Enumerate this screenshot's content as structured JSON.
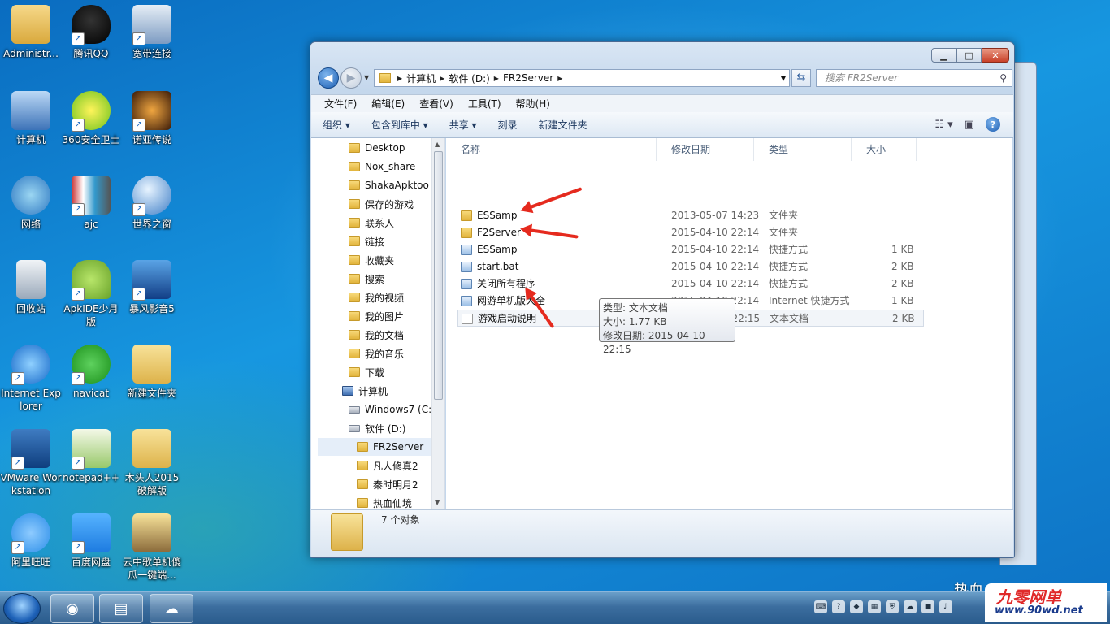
{
  "desktop": {
    "icons": [
      {
        "label": "Administr..."
      },
      {
        "label": "腾讯QQ"
      },
      {
        "label": "宽带连接"
      },
      {
        "label": "计算机"
      },
      {
        "label": "360安全卫士"
      },
      {
        "label": "诺亚传说"
      },
      {
        "label": "网络"
      },
      {
        "label": "ajc"
      },
      {
        "label": "世界之窗"
      },
      {
        "label": "回收站"
      },
      {
        "label": "ApkIDE少月版"
      },
      {
        "label": "暴风影音5"
      },
      {
        "label": "Internet Explorer"
      },
      {
        "label": "navicat"
      },
      {
        "label": "新建文件夹"
      },
      {
        "label": "VMware Workstation"
      },
      {
        "label": "notepad++"
      },
      {
        "label": "木头人2015破解版"
      },
      {
        "label": "阿里旺旺"
      },
      {
        "label": "百度网盘"
      },
      {
        "label": "云中歌单机傻瓜一键端..."
      }
    ]
  },
  "explorer": {
    "address": {
      "crumbs": [
        "计算机",
        "软件 (D:)",
        "FR2Server"
      ]
    },
    "search_placeholder": "搜索 FR2Server",
    "menu": [
      "文件(F)",
      "编辑(E)",
      "查看(V)",
      "工具(T)",
      "帮助(H)"
    ],
    "commands": [
      "组织 ▾",
      "包含到库中 ▾",
      "共享 ▾",
      "刻录",
      "新建文件夹"
    ],
    "nav_items": [
      {
        "label": "Desktop"
      },
      {
        "label": "Nox_share"
      },
      {
        "label": "ShakaApktoo"
      },
      {
        "label": "保存的游戏"
      },
      {
        "label": "联系人"
      },
      {
        "label": "链接"
      },
      {
        "label": "收藏夹"
      },
      {
        "label": "搜索"
      },
      {
        "label": "我的视频"
      },
      {
        "label": "我的图片"
      },
      {
        "label": "我的文档"
      },
      {
        "label": "我的音乐"
      },
      {
        "label": "下载"
      },
      {
        "label": "计算机"
      },
      {
        "label": "Windows7 (C:"
      },
      {
        "label": "软件 (D:)"
      },
      {
        "label": "FR2Server"
      },
      {
        "label": "凡人修真2一"
      },
      {
        "label": "秦时明月2"
      },
      {
        "label": "热血仙境"
      }
    ],
    "columns": [
      "名称",
      "修改日期",
      "类型",
      "大小"
    ],
    "files": [
      {
        "name": "ESSamp",
        "date": "2013-05-07 14:23",
        "type": "文件夹",
        "size": ""
      },
      {
        "name": "F2Server",
        "date": "2015-04-10 22:14",
        "type": "文件夹",
        "size": ""
      },
      {
        "name": "ESSamp",
        "date": "2015-04-10 22:14",
        "type": "快捷方式",
        "size": "1 KB"
      },
      {
        "name": "start.bat",
        "date": "2015-04-10 22:14",
        "type": "快捷方式",
        "size": "2 KB"
      },
      {
        "name": "关闭所有程序",
        "date": "2015-04-10 22:14",
        "type": "快捷方式",
        "size": "2 KB"
      },
      {
        "name": "网游单机版大全",
        "date": "2015-04-10 22:14",
        "type": "Internet 快捷方式",
        "size": "1 KB"
      },
      {
        "name": "游戏启动说明",
        "date": "2015-04-10 22:15",
        "type": "文本文档",
        "size": "2 KB"
      }
    ],
    "tooltip": {
      "type": "类型: 文本文档",
      "size": "大小: 1.77 KB",
      "date": "修改日期: 2015-04-10 22:15"
    },
    "status_count": "7 个对象"
  },
  "watermark": {
    "left_text": "热血",
    "brand": "九零网单",
    "url": "www.90wd.net"
  },
  "colors": {
    "arrow": "#e52a1e",
    "accent": "#1a5bb0"
  }
}
